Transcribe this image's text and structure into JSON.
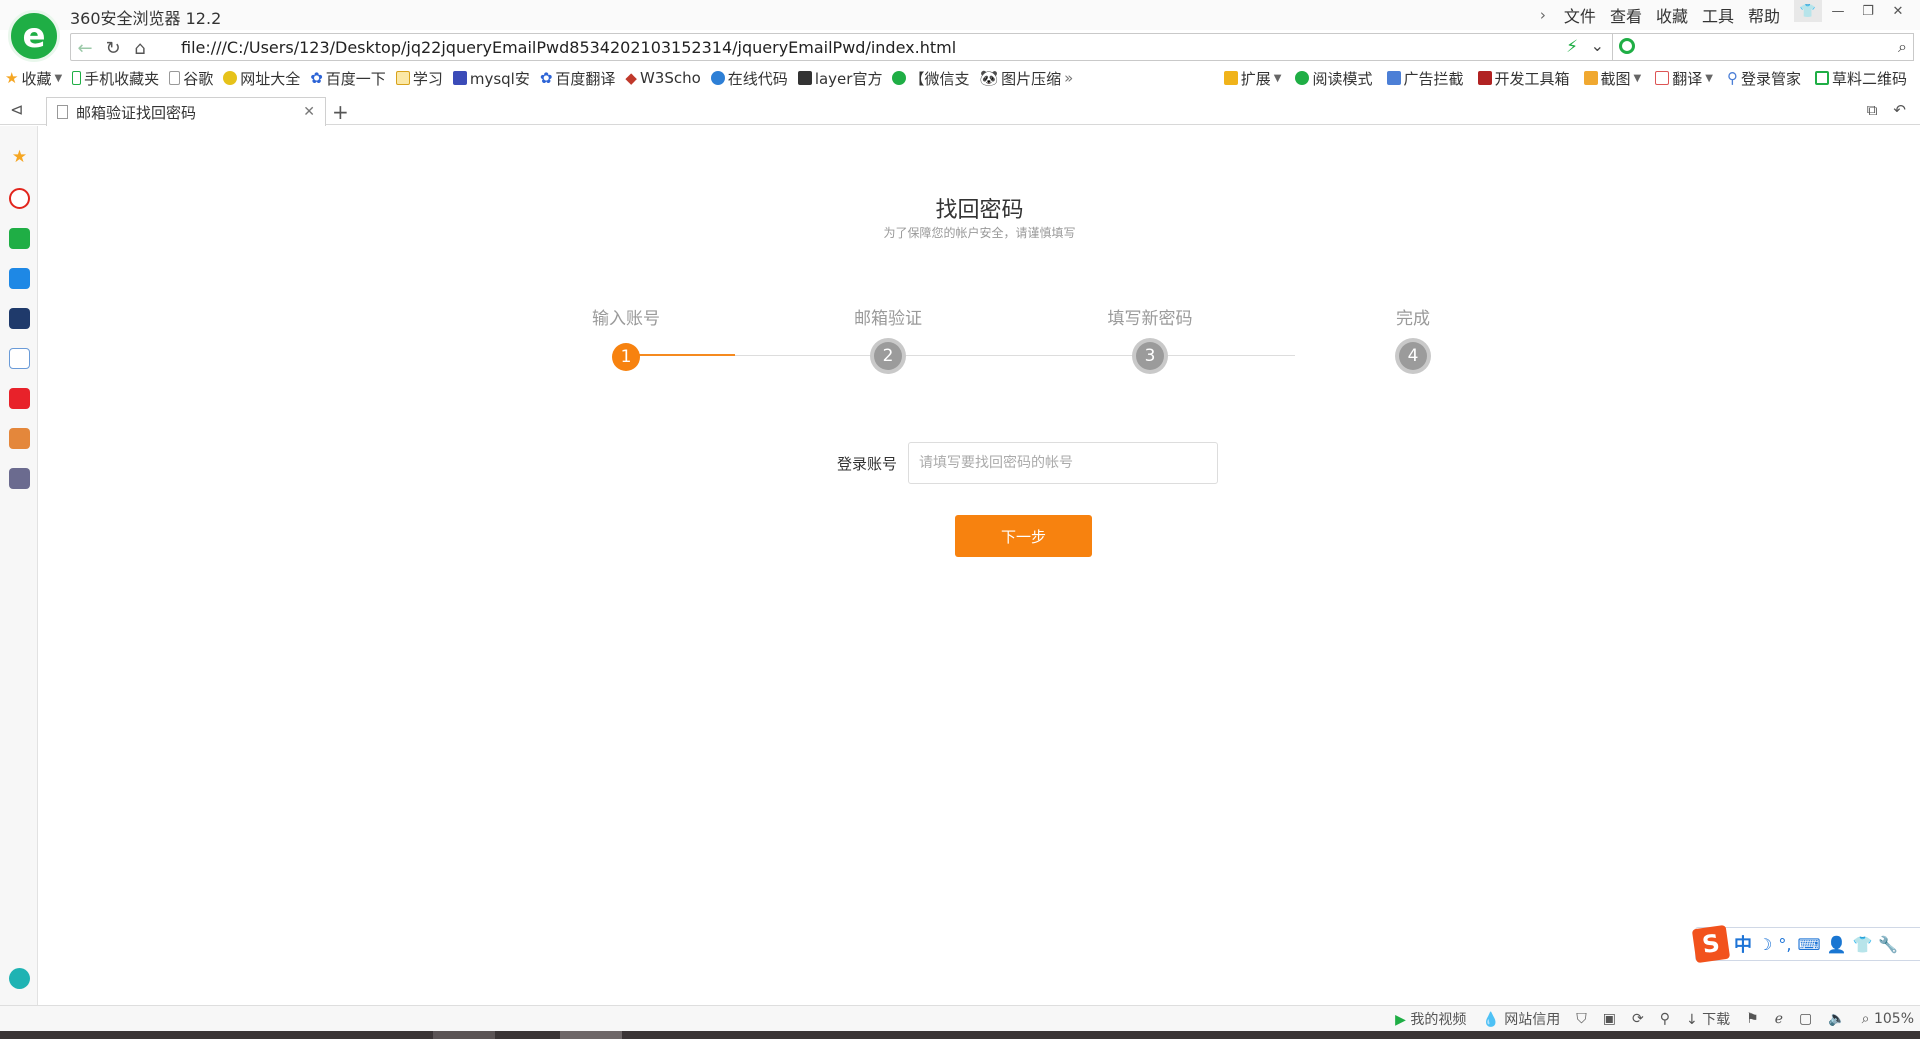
{
  "browser": {
    "title": "360安全浏览器 12.2",
    "menu": [
      "文件",
      "查看",
      "收藏",
      "工具",
      "帮助"
    ],
    "url": "file:///C:/Users/123/Desktop/jq22jqueryEmailPwd8534202103152314/jqueryEmailPwd/index.html",
    "search_placeholder": "",
    "bookmarks": [
      "收藏",
      "手机收藏夹",
      "谷歌",
      "网址大全",
      "百度一下",
      "学习",
      "mysql安",
      "百度翻译",
      "W3Scho",
      "在线代码",
      "layer官方",
      "【微信支",
      "图片压缩"
    ],
    "toolbar_right": [
      "扩展",
      "阅读模式",
      "广告拦截",
      "开发工具箱",
      "截图",
      "翻译",
      "登录管家",
      "草料二维码"
    ],
    "tab_title": "邮箱验证找回密码",
    "status_items": [
      "我的视频",
      "网站信用",
      "下载",
      "105%"
    ],
    "accent": "#1fae45"
  },
  "page": {
    "title": "找回密码",
    "subtitle": "为了保障您的帐户安全，请谨慎填写",
    "steps": [
      {
        "label": "输入账号",
        "num": "1",
        "state": "active"
      },
      {
        "label": "邮箱验证",
        "num": "2",
        "state": "inactive"
      },
      {
        "label": "填写新密码",
        "num": "3",
        "state": "inactive"
      },
      {
        "label": "完成",
        "num": "4",
        "state": "inactive"
      }
    ],
    "form": {
      "label": "登录账号",
      "value": "",
      "placeholder": "请填写要找回密码的帐号"
    },
    "next_button": "下一步",
    "accent": "#f7820f"
  },
  "ime": {
    "mode": "中"
  }
}
